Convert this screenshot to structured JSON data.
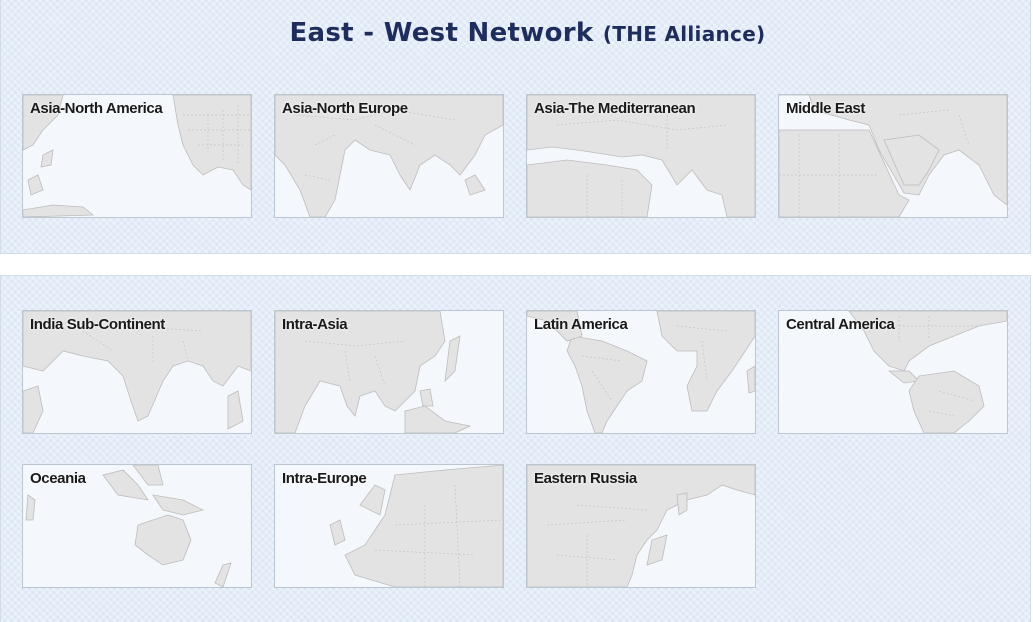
{
  "header": {
    "title_main": "East - West Network",
    "title_sub": "(THE Alliance)"
  },
  "colors": {
    "title": "#1f2d5c",
    "panel_bg": "#e4edf8",
    "tile_sea": "#f4f7fb",
    "tile_land": "#e3e3e3",
    "tile_border": "#bcc6d1"
  },
  "tiles": [
    {
      "label": "Asia-North America",
      "icon": "world-map-pacific-icon"
    },
    {
      "label": "Asia-North Europe",
      "icon": "world-map-eurasia-icon"
    },
    {
      "label": "Asia-The Mediterranean",
      "icon": "world-map-mediterranean-icon"
    },
    {
      "label": "Middle East",
      "icon": "world-map-middle-east-icon"
    },
    {
      "label": "India Sub-Continent",
      "icon": "world-map-india-icon"
    },
    {
      "label": "Intra-Asia",
      "icon": "world-map-asia-icon"
    },
    {
      "label": "Latin America",
      "icon": "world-map-south-america-icon"
    },
    {
      "label": "Central America",
      "icon": "world-map-central-america-icon"
    },
    {
      "label": "Oceania",
      "icon": "world-map-oceania-icon"
    },
    {
      "label": "Intra-Europe",
      "icon": "world-map-europe-icon"
    },
    {
      "label": "Eastern Russia",
      "icon": "world-map-east-russia-icon"
    }
  ]
}
